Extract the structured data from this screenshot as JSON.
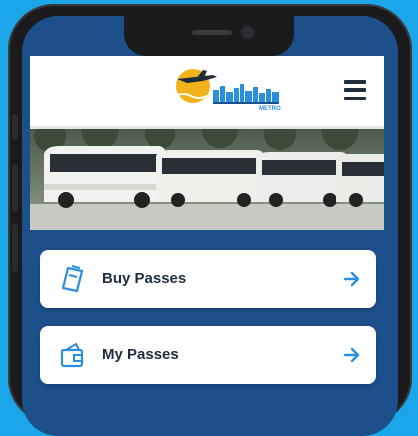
{
  "app": {
    "logo_alt": "Metro logo",
    "logo_text": "METRO"
  },
  "banner": {
    "description": "Row of transit buses"
  },
  "actions": [
    {
      "label": "Buy Passes",
      "icon": "ticket-icon"
    },
    {
      "label": "My Passes",
      "icon": "wallet-icon"
    }
  ],
  "colors": {
    "background": "#1aa6e8",
    "screen": "#1d4f8a",
    "accent": "#2b8fe0",
    "logo_sun": "#f2b21a",
    "text": "#1f2d3d"
  }
}
